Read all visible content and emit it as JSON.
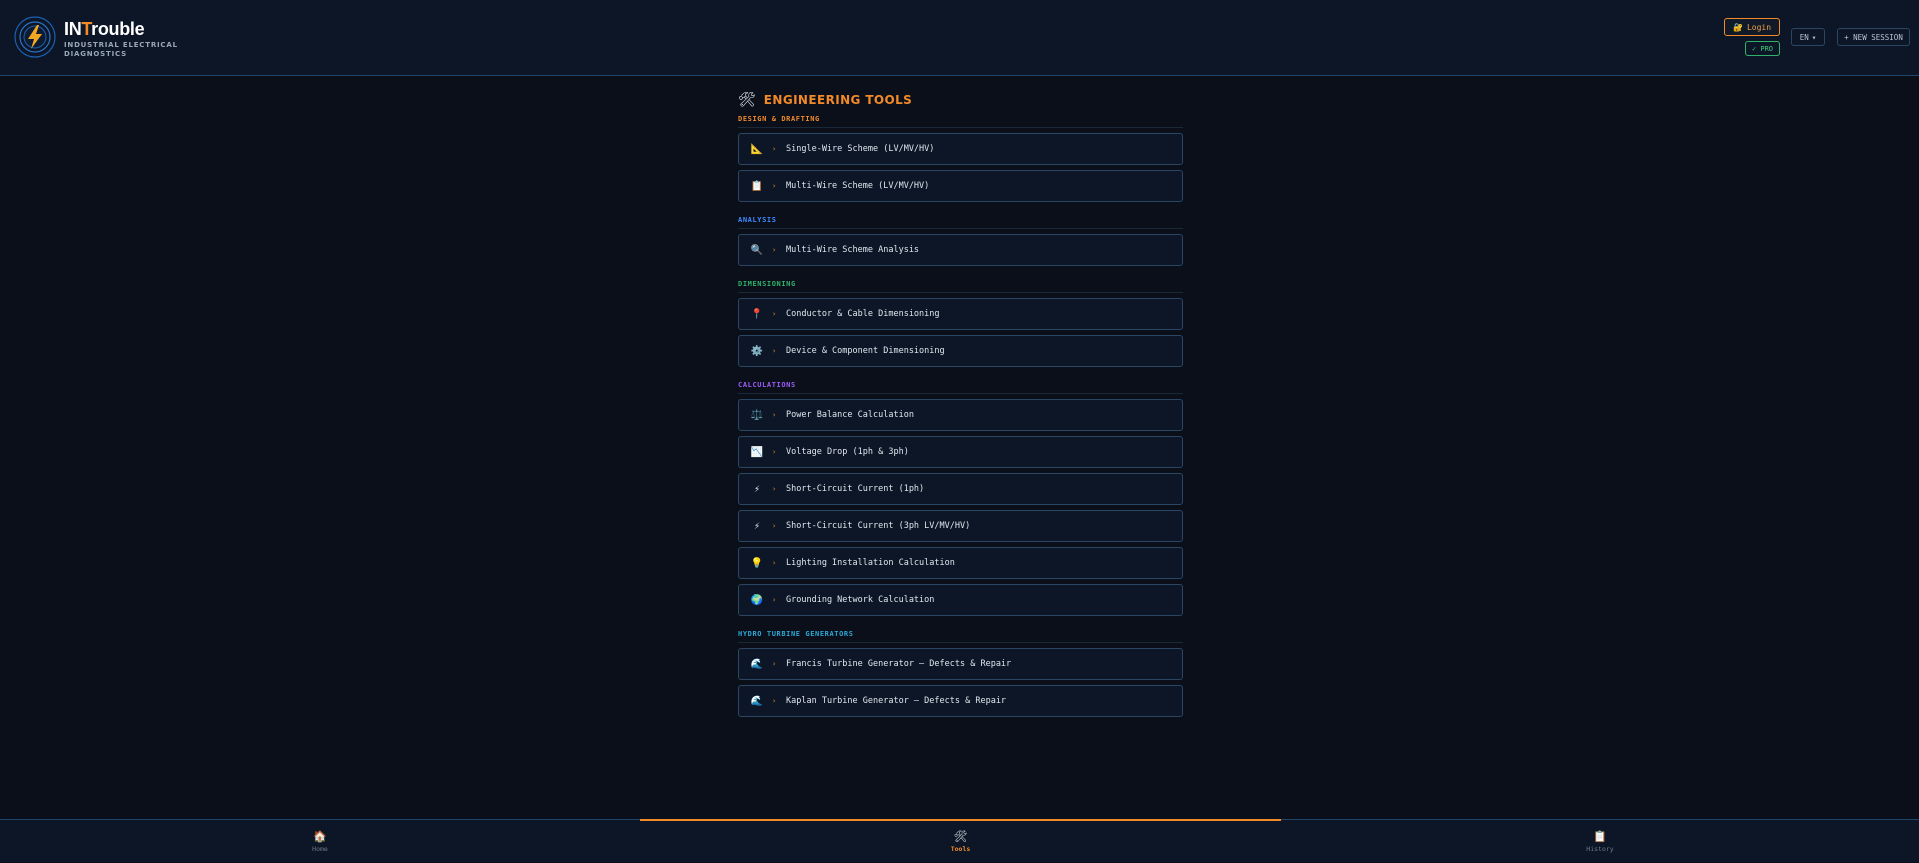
{
  "header": {
    "brand_prefix": "IN",
    "brand_highlight": "T",
    "brand_rest": "rouble",
    "brand_subtitle": "INDUSTRIAL ELECTRICAL DIAGNOSTICS",
    "login_icon": "🔐",
    "login_label": "Login",
    "pro_badge": "✓ PRO",
    "lang_label": "EN",
    "lang_caret": "▾",
    "new_session_label": "+ NEW SESSION"
  },
  "page": {
    "title_icon": "🛠",
    "title": "ENGINEERING TOOLS"
  },
  "sections": [
    {
      "label": "DESIGN & DRAFTING",
      "color": "#f28a28",
      "items": [
        {
          "icon": "📐",
          "label": "Single-Wire Scheme (LV/MV/HV)"
        },
        {
          "icon": "📋",
          "label": "Multi-Wire Scheme (LV/MV/HV)"
        }
      ]
    },
    {
      "label": "ANALYSIS",
      "color": "#3d8bff",
      "items": [
        {
          "icon": "🔍",
          "label": "Multi-Wire Scheme Analysis"
        }
      ]
    },
    {
      "label": "DIMENSIONING",
      "color": "#2fb36a",
      "items": [
        {
          "icon": "📍",
          "label": "Conductor & Cable Dimensioning"
        },
        {
          "icon": "⚙️",
          "label": "Device & Component Dimensioning"
        }
      ]
    },
    {
      "label": "CALCULATIONS",
      "color": "#9b5cf6",
      "items": [
        {
          "icon": "⚖️",
          "label": "Power Balance Calculation"
        },
        {
          "icon": "📉",
          "label": "Voltage Drop (1ph & 3ph)"
        },
        {
          "icon": "⚡",
          "label": "Short-Circuit Current (1ph)"
        },
        {
          "icon": "⚡",
          "label": "Short-Circuit Current (3ph LV/MV/HV)"
        },
        {
          "icon": "💡",
          "label": "Lighting Installation Calculation"
        },
        {
          "icon": "🌍",
          "label": "Grounding Network Calculation"
        }
      ]
    },
    {
      "label": "HYDRO TURBINE GENERATORS",
      "color": "#2aa9d6",
      "items": [
        {
          "icon": "🌊",
          "label": "Francis Turbine Generator — Defects & Repair"
        },
        {
          "icon": "🌊",
          "label": "Kaplan Turbine Generator — Defects & Repair"
        }
      ]
    }
  ],
  "nav": [
    {
      "icon": "🏠",
      "label": "Home"
    },
    {
      "icon": "🛠",
      "label": "Tools"
    },
    {
      "icon": "📋",
      "label": "History"
    }
  ],
  "arrow_glyph": "›",
  "colors": {
    "accent": "#f28a28",
    "background": "#0a0f1a",
    "panel": "#0c1626",
    "border": "#2b4663"
  }
}
